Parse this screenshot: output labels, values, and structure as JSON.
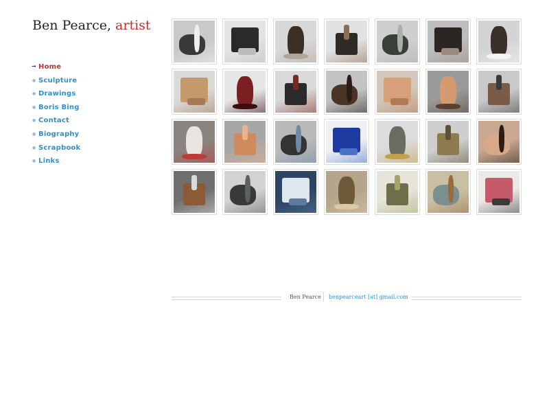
{
  "site": {
    "name": "Ben Pearce,",
    "role": "artist"
  },
  "nav": {
    "items": [
      {
        "label": "Home",
        "active": true
      },
      {
        "label": "Sculpture",
        "active": false
      },
      {
        "label": "Drawings",
        "active": false
      },
      {
        "label": "Boris Bing",
        "active": false
      },
      {
        "label": "Contact",
        "active": false
      },
      {
        "label": "Biography",
        "active": false
      },
      {
        "label": "Scrapbook",
        "active": false
      },
      {
        "label": "Links",
        "active": false
      }
    ]
  },
  "gallery": {
    "rows": [
      [
        {
          "bg": "#c9c9c9",
          "fg": "#3a3a3a",
          "accent": "#efefef"
        },
        {
          "bg": "#e3e3e3",
          "fg": "#2a2a2a",
          "accent": "#bcbcbc"
        },
        {
          "bg": "#d8d8d8",
          "fg": "#3b2e24",
          "accent": "#b1a69b"
        },
        {
          "bg": "#e2e2e2",
          "fg": "#2e2a26",
          "accent": "#8e6e52"
        },
        {
          "bg": "#cfcfcf",
          "fg": "#3a3f3a",
          "accent": "#a9b0a9"
        },
        {
          "bg": "#bdbdbd",
          "fg": "#2b2623",
          "accent": "#9b8b7f"
        },
        {
          "bg": "#d4d4d4",
          "fg": "#3b2f2a",
          "accent": "#f3f3f3"
        }
      ],
      [
        {
          "bg": "#dadada",
          "fg": "#c49a6c",
          "accent": "#a47954"
        },
        {
          "bg": "#e6e6e6",
          "fg": "#7a1f22",
          "accent": "#3b0d0f"
        },
        {
          "bg": "#d9d9d9",
          "fg": "#2b2b2b",
          "accent": "#7b2a23"
        },
        {
          "bg": "#c3c3c3",
          "fg": "#4a3426",
          "accent": "#2b1d15"
        },
        {
          "bg": "#d3c7bb",
          "fg": "#d8a07a",
          "accent": "#b07a56"
        },
        {
          "bg": "#9a9a9a",
          "fg": "#d59a70",
          "accent": "#5a4030"
        },
        {
          "bg": "#c9c9c9",
          "fg": "#7a5a48",
          "accent": "#3a3a3a"
        }
      ],
      [
        {
          "bg": "#8a8480",
          "fg": "#e9e4df",
          "accent": "#c2393a"
        },
        {
          "bg": "#a7a7a7",
          "fg": "#cf8b5d",
          "accent": "#e7b48e"
        },
        {
          "bg": "#b9b9b9",
          "fg": "#333333",
          "accent": "#6c8aa6"
        },
        {
          "bg": "#f0f0f4",
          "fg": "#1d3aa0",
          "accent": "#4a72c9"
        },
        {
          "bg": "#dcdcdc",
          "fg": "#6a6d64",
          "accent": "#c3a04a"
        },
        {
          "bg": "#cfcfcf",
          "fg": "#8e7b4e",
          "accent": "#5e5236"
        },
        {
          "bg": "#c8a890",
          "fg": "#d8a88a",
          "accent": "#2b1d15"
        }
      ],
      [
        {
          "bg": "#6f6f6f",
          "fg": "#8c5a35",
          "accent": "#d9d9d9"
        },
        {
          "bg": "#d2d2d2",
          "fg": "#37393a",
          "accent": "#5c625e"
        },
        {
          "bg": "#2d4563",
          "fg": "#dfe7ee",
          "accent": "#5d7aa0"
        },
        {
          "bg": "#b6a58a",
          "fg": "#6e5a3a",
          "accent": "#d8c9a8"
        },
        {
          "bg": "#e7e4da",
          "fg": "#6f6e4a",
          "accent": "#a5a56a"
        },
        {
          "bg": "#c9c0a3",
          "fg": "#7a8f8f",
          "accent": "#9a6b3e"
        },
        {
          "bg": "#ece9e4",
          "fg": "#c45a6a",
          "accent": "#3b3b3b"
        }
      ]
    ]
  },
  "footer": {
    "name": "Ben Pearce",
    "email": "benpearceart [at] gmail.com"
  }
}
